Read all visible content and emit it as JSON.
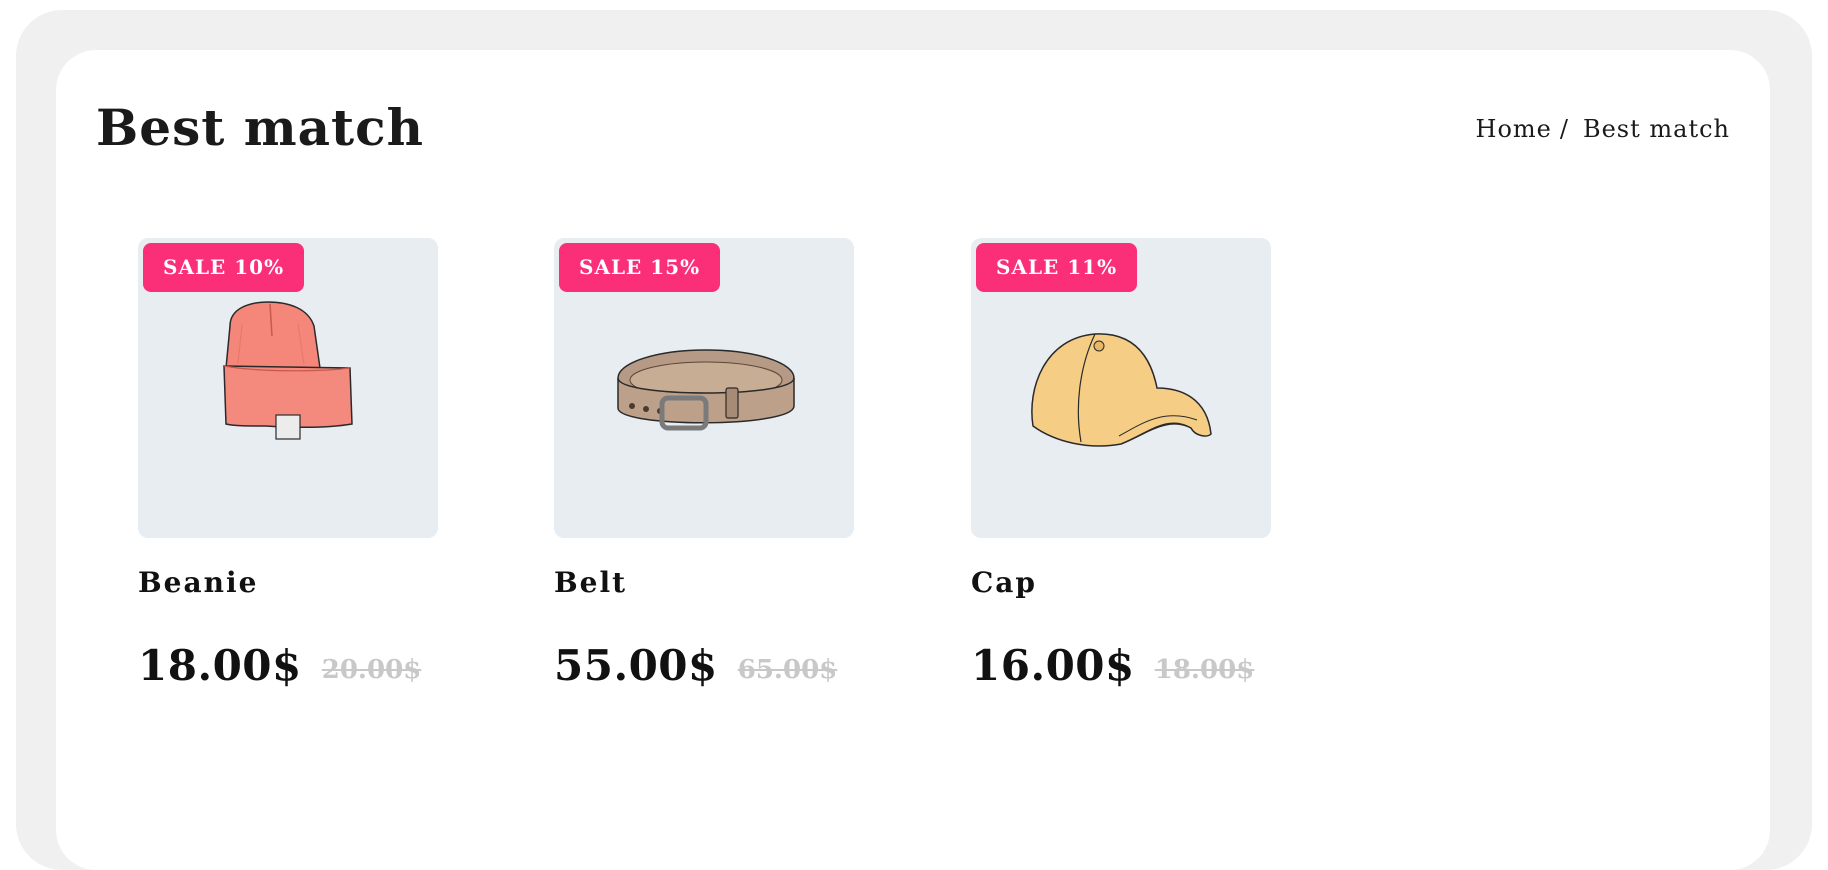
{
  "page": {
    "title": "Best match"
  },
  "breadcrumb": {
    "home": "Home",
    "separator": "/",
    "current": "Best match"
  },
  "products": [
    {
      "name": "Beanie",
      "badge": "SALE 10%",
      "price": "18.00$",
      "old_price": "20.00$",
      "image": "beanie-illustration"
    },
    {
      "name": "Belt",
      "badge": "SALE 15%",
      "price": "55.00$",
      "old_price": "65.00$",
      "image": "belt-illustration"
    },
    {
      "name": "Cap",
      "badge": "SALE 11%",
      "price": "16.00$",
      "old_price": "18.00$",
      "image": "cap-illustration"
    }
  ],
  "colors": {
    "badge": "#fb2e78",
    "thumb_bg": "#e8edf2",
    "outer_bg": "#f0f0f0",
    "old_price": "#c8c8c8"
  }
}
